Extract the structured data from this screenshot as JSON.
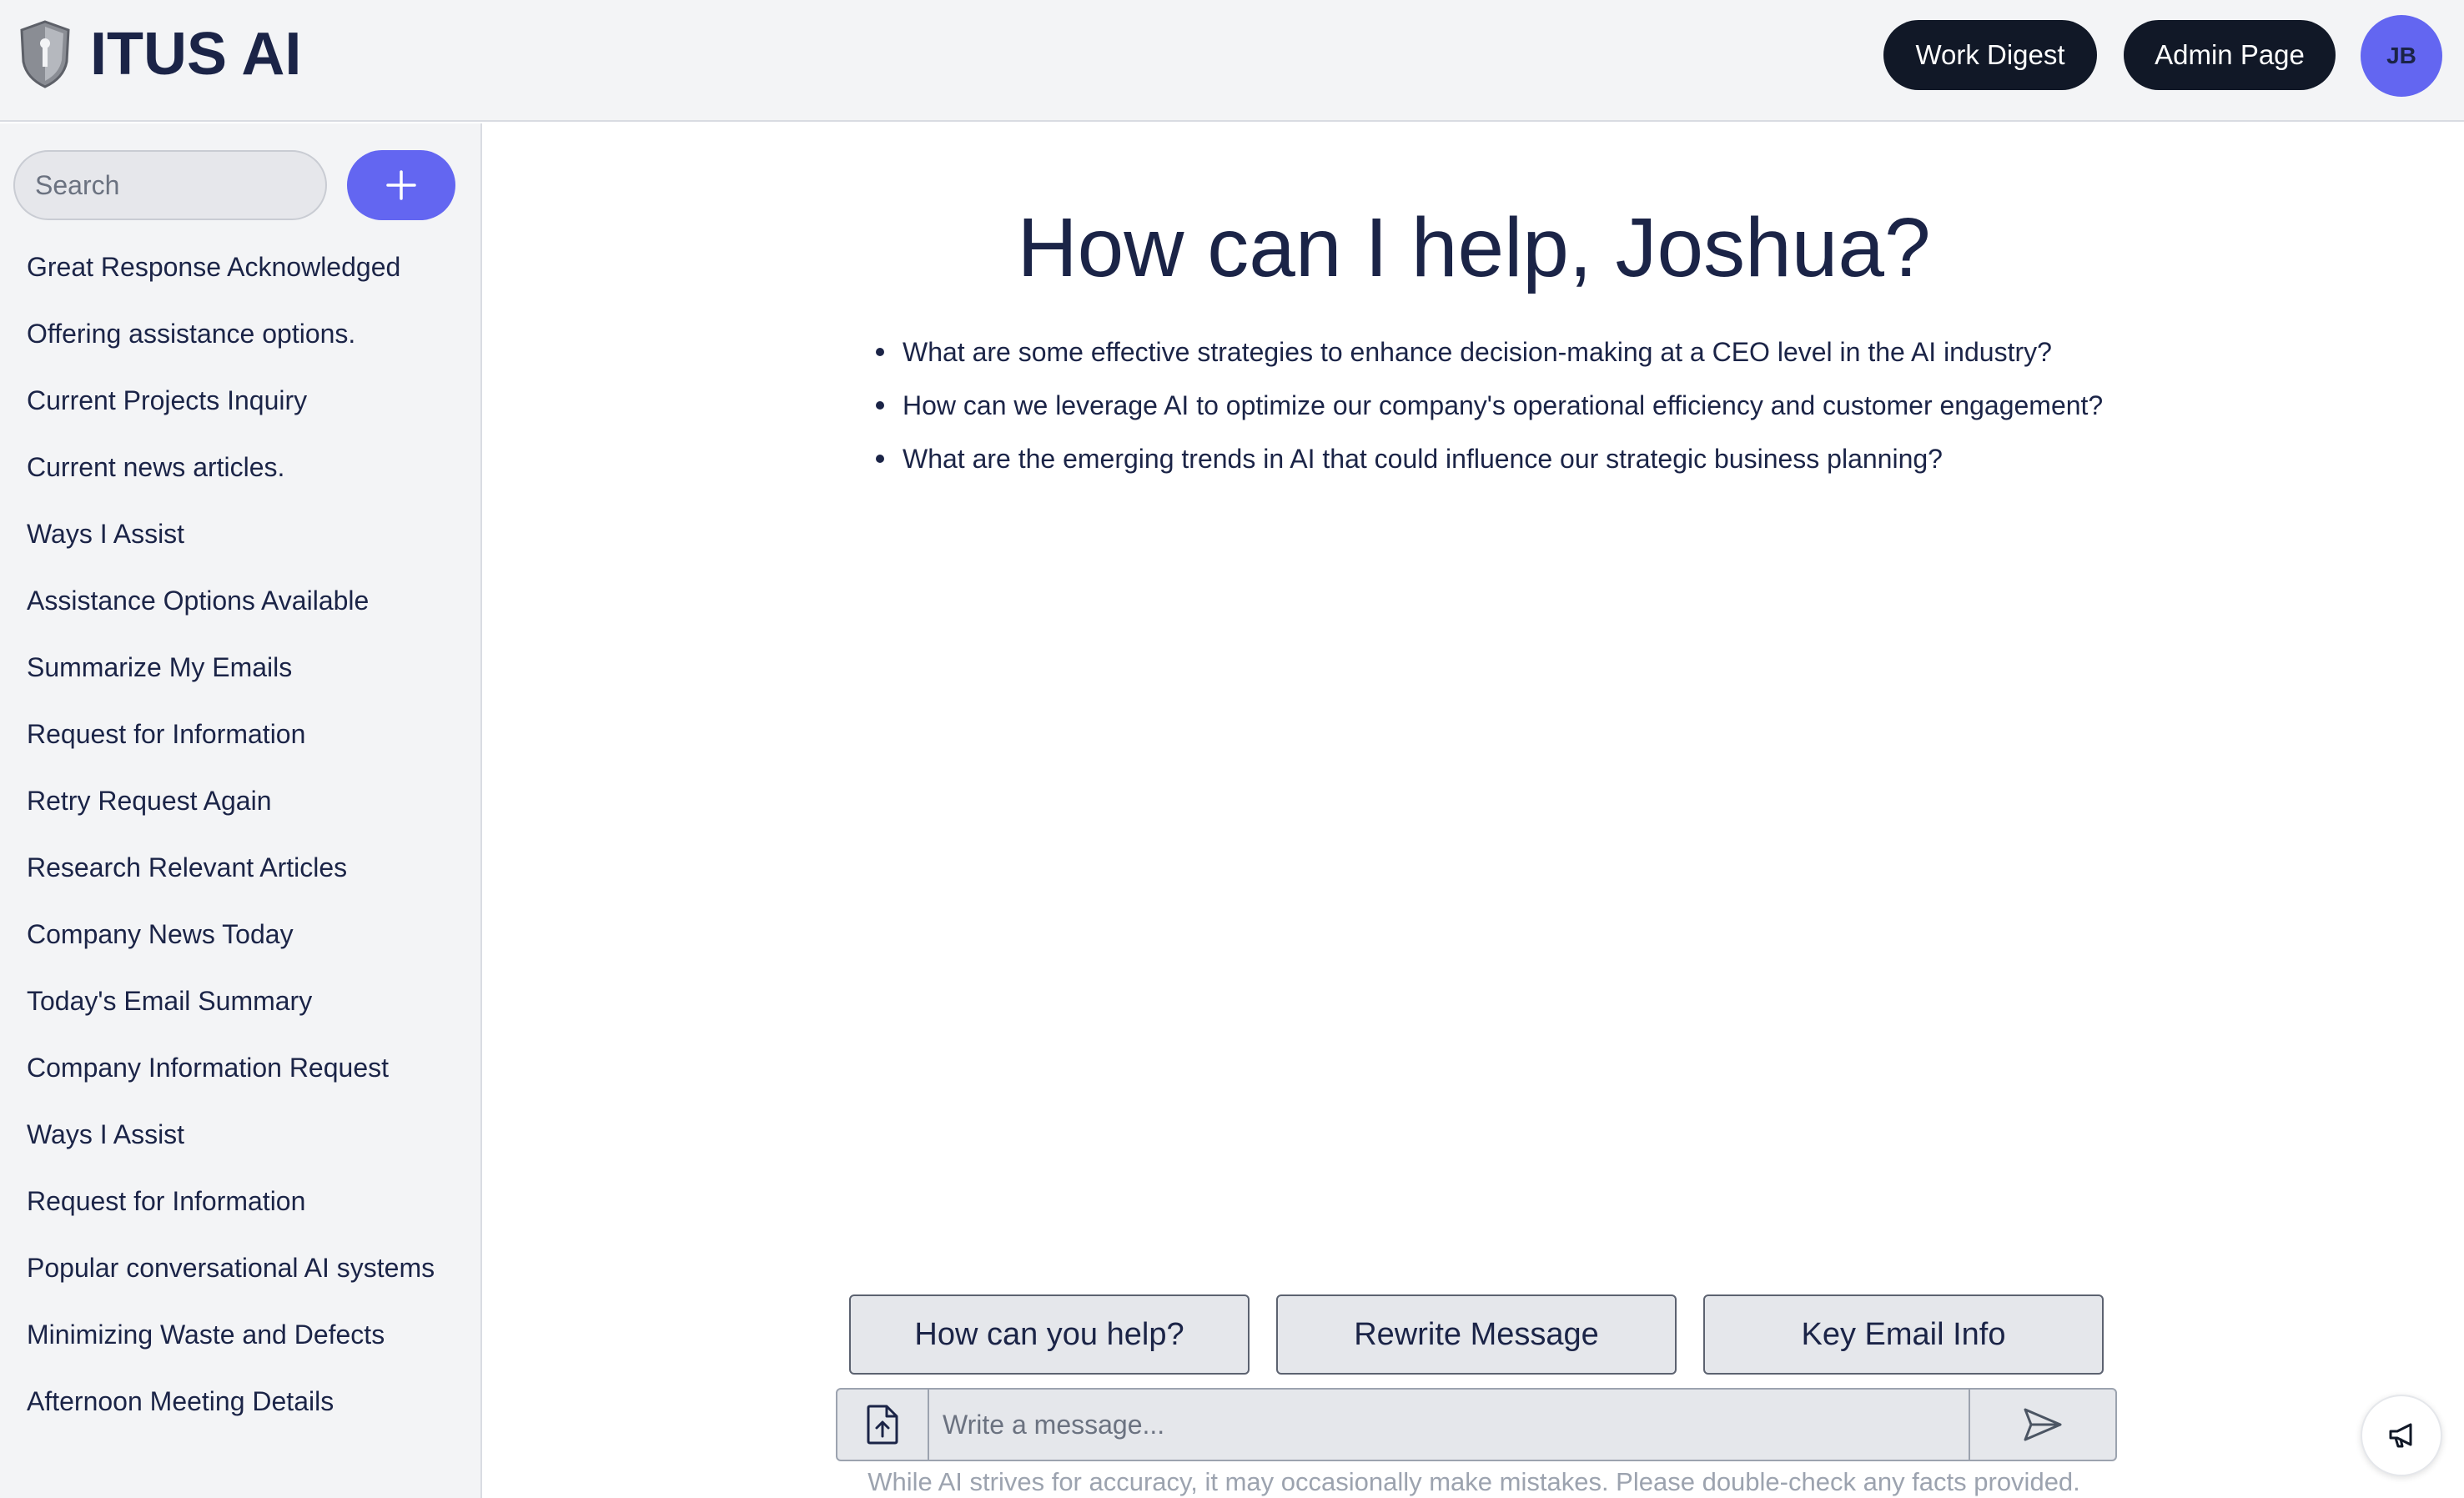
{
  "header": {
    "brand": "ITUS AI",
    "work_digest_label": "Work Digest",
    "admin_page_label": "Admin Page",
    "avatar_initials": "JB"
  },
  "sidebar": {
    "search_placeholder": "Search",
    "items": [
      "Great Response Acknowledged",
      "Offering assistance options.",
      "Current Projects Inquiry",
      "Current news articles.",
      "Ways I Assist",
      "Assistance Options Available",
      "Summarize My Emails",
      "Request for Information",
      "Retry Request Again",
      "Research Relevant Articles",
      "Company News Today",
      "Today's Email Summary",
      "Company Information Request",
      "Ways I Assist",
      "Request for Information",
      "Popular conversational AI systems",
      "Minimizing Waste and Defects",
      "Afternoon Meeting Details"
    ]
  },
  "main": {
    "greeting": "How can I help, Joshua?",
    "suggestions": [
      "What are some effective strategies to enhance decision-making at a CEO level in the AI industry?",
      "How can we leverage AI to optimize our company's operational efficiency and customer engagement?",
      "What are the emerging trends in AI that could influence our strategic business planning?"
    ],
    "quick_actions": [
      "How can you help?",
      "Rewrite Message",
      "Key Email Info"
    ],
    "message_placeholder": "Write a message...",
    "disclaimer": "While AI strives for accuracy, it may occasionally make mistakes. Please double-check any facts provided."
  },
  "icons": {
    "logo": "shield-logo-icon",
    "new_chat": "plus-icon",
    "attach": "file-upload-icon",
    "send": "send-icon",
    "feedback": "megaphone-icon"
  },
  "colors": {
    "accent": "#6366f1",
    "dark_button": "#111827",
    "text": "#1b2447",
    "panel": "#f3f4f6"
  }
}
